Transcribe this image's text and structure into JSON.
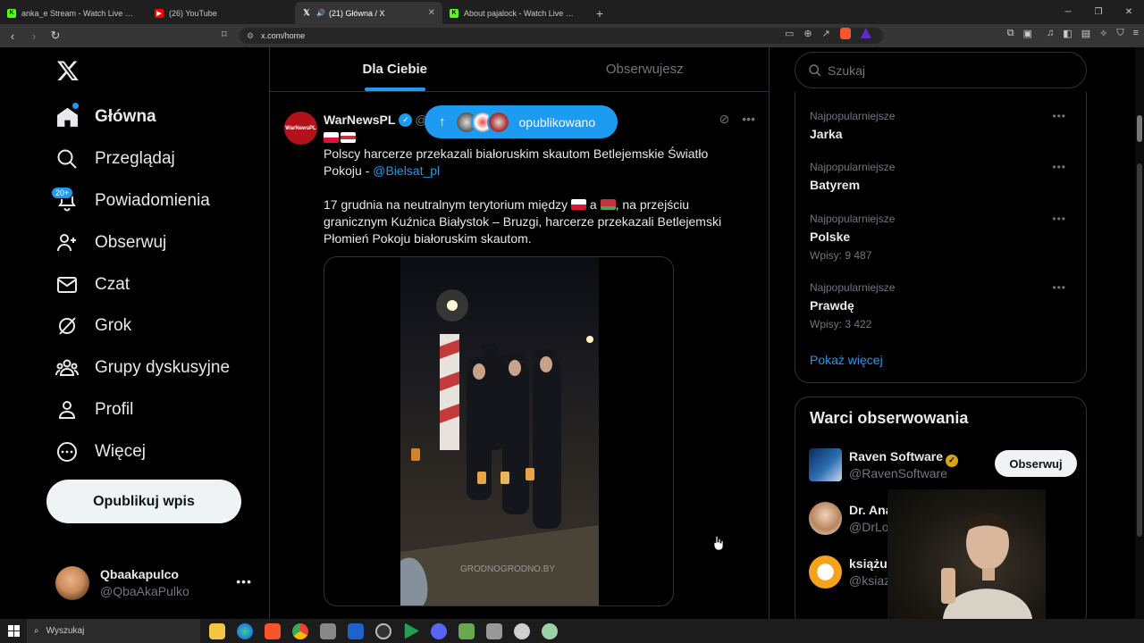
{
  "browser": {
    "tabs": [
      {
        "title": "anka_e Stream - Watch Live on Kick",
        "fav": "K",
        "favColor": "#53fc18",
        "active": false
      },
      {
        "title": "(26) YouTube",
        "fav": "▶",
        "favColor": "#ff0000",
        "active": false
      },
      {
        "title": "(21) Główna / X",
        "fav": "X",
        "favColor": "#000000",
        "active": true
      },
      {
        "title": "About pajalock - Watch Live on Kick",
        "fav": "K",
        "favColor": "#53fc18",
        "active": false
      }
    ],
    "url": "x.com/home"
  },
  "nav": {
    "items": [
      {
        "label": "Główna",
        "icon": "home-icon"
      },
      {
        "label": "Przeglądaj",
        "icon": "search-icon"
      },
      {
        "label": "Powiadomienia",
        "icon": "bell-icon"
      },
      {
        "label": "Obserwuj",
        "icon": "follow-icon"
      },
      {
        "label": "Czat",
        "icon": "mail-icon"
      },
      {
        "label": "Grok",
        "icon": "grok-icon"
      },
      {
        "label": "Grupy dyskusyjne",
        "icon": "communities-icon"
      },
      {
        "label": "Profil",
        "icon": "profile-icon"
      },
      {
        "label": "Więcej",
        "icon": "more-icon"
      }
    ],
    "notif_badge": "20+",
    "post_button": "Opublikuj wpis",
    "account": {
      "name": "Qbaakapulco",
      "handle": "@QbaAkaPulko"
    }
  },
  "timeline": {
    "tabs": [
      "Dla Ciebie",
      "Obserwujesz"
    ],
    "active_tab": 0,
    "new_posts_pill": "opublikowano",
    "post": {
      "author": "WarNewsPL",
      "handle_peek": "@",
      "avatar_text": "WarNewsPL",
      "text1": "Polscy harcerze przekazali białoruskim skautom Betlejemskie Światło Pokoju - ",
      "mention": "@Bielsat_pl",
      "text2a": "17 grudnia na neutralnym terytorium między ",
      "text2b": " a ",
      "text2c": ", na przejściu granicznym Kuźnica Białystok – Bruzgi, harcerze przekazali Betlejemski Płomień Pokoju białoruskim skautom.",
      "watermark": "GRODNOGRODNO.BY"
    }
  },
  "right": {
    "search_placeholder": "Szukaj",
    "trends": [
      {
        "category": "Najpopularniejsze",
        "name": "Jarka",
        "posts": ""
      },
      {
        "category": "Najpopularniejsze",
        "name": "Batyrem",
        "posts": ""
      },
      {
        "category": "Najpopularniejsze",
        "name": "Polske",
        "posts": "Wpisy: 9 487"
      },
      {
        "category": "Najpopularniejsze",
        "name": "Prawdę",
        "posts": "Wpisy: 3 422"
      }
    ],
    "show_more": "Pokaż więcej",
    "who_title": "Warci obserwowania",
    "who": [
      {
        "name": "Raven Software",
        "handle": "@RavenSoftware",
        "follow": "Obserwuj"
      },
      {
        "name": "Dr. Ana",
        "handle": "@DrLo",
        "follow": ""
      },
      {
        "name": "książu",
        "handle": "@ksiaz",
        "follow": ""
      }
    ]
  },
  "taskbar": {
    "search_placeholder": "Wyszukaj"
  },
  "colors": {
    "accent": "#1d9bf0",
    "bg": "#000000",
    "border": "#2f3336",
    "muted": "#71767b"
  }
}
